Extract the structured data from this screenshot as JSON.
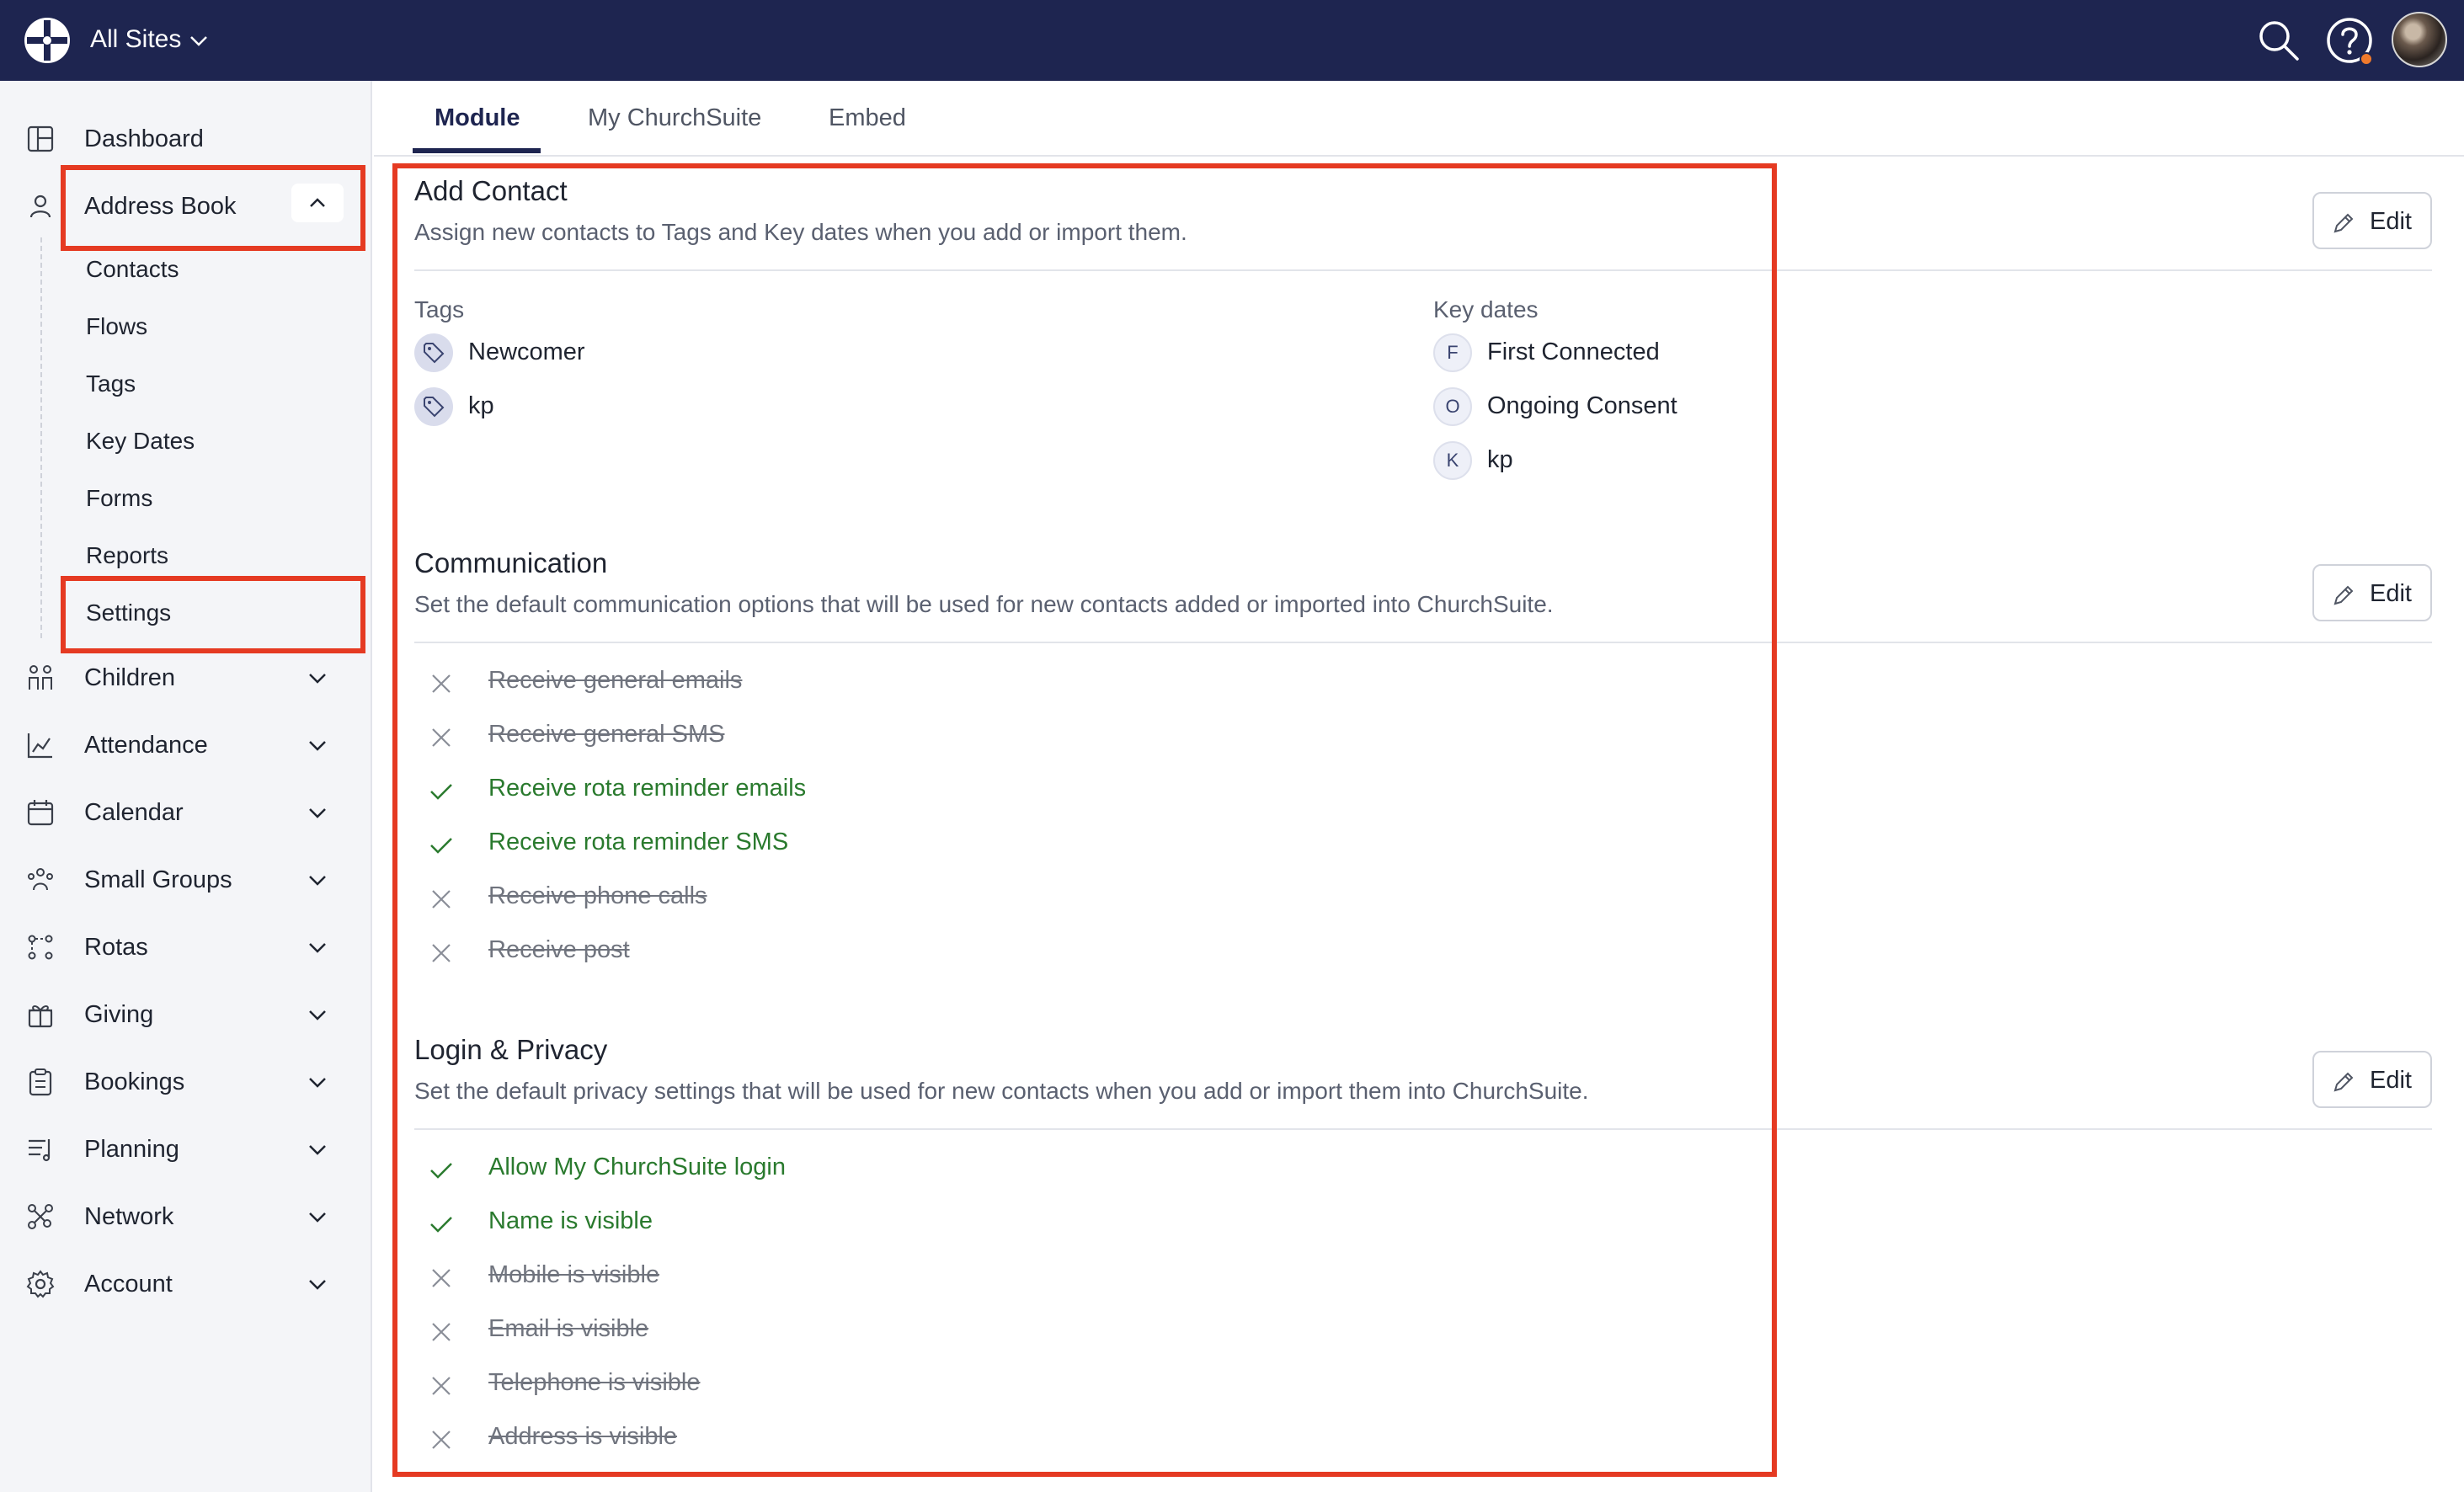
{
  "header": {
    "site_selector": "All Sites",
    "icons": [
      "logo-icon",
      "search-icon",
      "help-icon",
      "avatar"
    ]
  },
  "sidebar": {
    "items": [
      {
        "label": "Dashboard",
        "icon": "dashboard-icon"
      },
      {
        "label": "Address Book",
        "icon": "person-icon",
        "expanded": true
      },
      {
        "label": "Children",
        "icon": "children-icon"
      },
      {
        "label": "Attendance",
        "icon": "attendance-chart-icon"
      },
      {
        "label": "Calendar",
        "icon": "calendar-icon"
      },
      {
        "label": "Small Groups",
        "icon": "small-groups-icon"
      },
      {
        "label": "Rotas",
        "icon": "rotas-icon"
      },
      {
        "label": "Giving",
        "icon": "gift-icon"
      },
      {
        "label": "Bookings",
        "icon": "bookings-icon"
      },
      {
        "label": "Planning",
        "icon": "planning-icon"
      },
      {
        "label": "Network",
        "icon": "network-icon"
      },
      {
        "label": "Account",
        "icon": "gear-icon"
      }
    ],
    "address_book_sub": [
      "Contacts",
      "Flows",
      "Tags",
      "Key Dates",
      "Forms",
      "Reports",
      "Settings"
    ]
  },
  "tabs": [
    {
      "label": "Module",
      "active": true
    },
    {
      "label": "My ChurchSuite",
      "active": false
    },
    {
      "label": "Embed",
      "active": false
    }
  ],
  "sections": {
    "add_contact": {
      "title": "Add Contact",
      "desc": "Assign new contacts to Tags and Key dates when you add or import them.",
      "edit": "Edit",
      "tags_label": "Tags",
      "tags": [
        "Newcomer",
        "kp"
      ],
      "keydates_label": "Key dates",
      "keydates": [
        {
          "initial": "F",
          "label": "First Connected"
        },
        {
          "initial": "O",
          "label": "Ongoing Consent"
        },
        {
          "initial": "K",
          "label": "kp"
        }
      ]
    },
    "communication": {
      "title": "Communication",
      "desc": "Set the default communication options that will be used for new contacts added or imported into ChurchSuite.",
      "edit": "Edit",
      "options": [
        {
          "label": "Receive general emails",
          "enabled": false
        },
        {
          "label": "Receive general SMS",
          "enabled": false
        },
        {
          "label": "Receive rota reminder emails",
          "enabled": true
        },
        {
          "label": "Receive rota reminder SMS",
          "enabled": true
        },
        {
          "label": "Receive phone calls",
          "enabled": false
        },
        {
          "label": "Receive post",
          "enabled": false
        }
      ]
    },
    "login_privacy": {
      "title": "Login & Privacy",
      "desc": "Set the default privacy settings that will be used for new contacts when you add or import them into ChurchSuite.",
      "edit": "Edit",
      "options": [
        {
          "label": "Allow My ChurchSuite login",
          "enabled": true
        },
        {
          "label": "Name is visible",
          "enabled": true
        },
        {
          "label": "Mobile is visible",
          "enabled": false
        },
        {
          "label": "Email is visible",
          "enabled": false
        },
        {
          "label": "Telephone is visible",
          "enabled": false
        },
        {
          "label": "Address is visible",
          "enabled": false
        }
      ]
    }
  },
  "colors": {
    "topbar": "#1e2550",
    "highlight": "#e53a22",
    "enabled": "#2a7a2e",
    "disabled": "#70747e"
  }
}
